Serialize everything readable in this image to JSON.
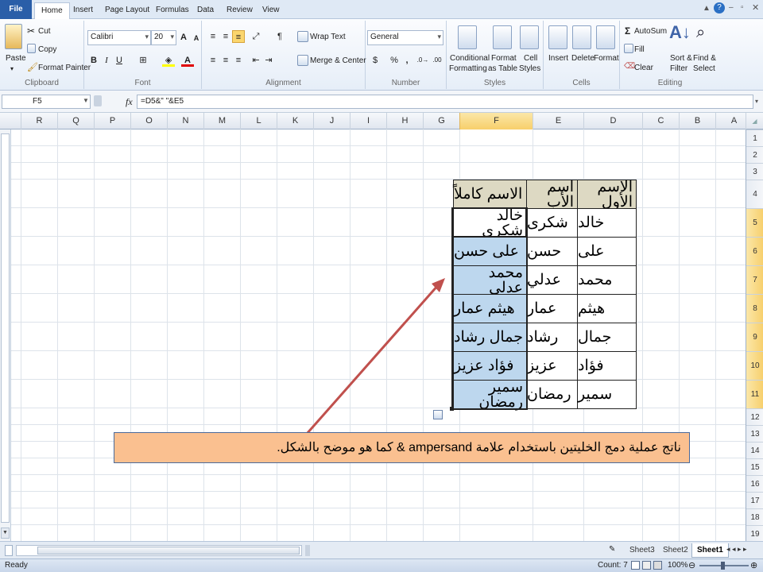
{
  "ribbon_tabs": [
    "File",
    "Home",
    "Insert",
    "Page Layout",
    "Formulas",
    "Data",
    "Review",
    "View"
  ],
  "clipboard": {
    "paste": "Paste",
    "cut": "Cut",
    "copy": "Copy",
    "format_painter": "Format Painter",
    "label": "Clipboard"
  },
  "font": {
    "name": "Calibri",
    "size": "20",
    "bold": "B",
    "italic": "I",
    "underline": "U",
    "label": "Font"
  },
  "alignment": {
    "wrap": "Wrap Text",
    "merge": "Merge & Center",
    "label": "Alignment"
  },
  "number": {
    "format": "General",
    "currency": "$",
    "percent": "%",
    "comma": ",",
    "label": "Number"
  },
  "styles": {
    "cond1": "Conditional",
    "cond2": "Formatting",
    "fmt1": "Format",
    "fmt2": "as Table",
    "cell1": "Cell",
    "cell2": "Styles",
    "label": "Styles"
  },
  "cells": {
    "insert": "Insert",
    "delete": "Delete",
    "format": "Format",
    "label": "Cells"
  },
  "editing": {
    "autosum": "AutoSum",
    "fill": "Fill",
    "clear": "Clear",
    "sort1": "Sort &",
    "sort2": "Filter",
    "find1": "Find &",
    "find2": "Select",
    "label": "Editing"
  },
  "formula_bar": {
    "name_box": "F5",
    "fx": "fx",
    "formula": "=D5&\" \"&E5"
  },
  "columns": [
    "R",
    "Q",
    "P",
    "O",
    "N",
    "M",
    "L",
    "K",
    "J",
    "I",
    "H",
    "G",
    "F",
    "E",
    "D",
    "C",
    "B",
    "A"
  ],
  "rows": [
    "1",
    "2",
    "3",
    "4",
    "5",
    "6",
    "7",
    "8",
    "9",
    "10",
    "11",
    "12",
    "13",
    "14",
    "15",
    "16",
    "17",
    "18",
    "19"
  ],
  "table": {
    "headers": [
      "الاسم كاملاً",
      "اسم الأب",
      "الاسم الأول"
    ],
    "rows": [
      [
        "خالد شكرى",
        "شكرى",
        "خالد"
      ],
      [
        "على حسن",
        "حسن",
        "على"
      ],
      [
        "محمد عدلي",
        "عدلي",
        "محمد"
      ],
      [
        "هيثم عمار",
        "عمار",
        "هيثم"
      ],
      [
        "جمال رشاد",
        "رشاد",
        "جمال"
      ],
      [
        "فؤاد عزيز",
        "عزيز",
        "فؤاد"
      ],
      [
        "سمير رمضان",
        "رمضان",
        "سمير"
      ]
    ]
  },
  "callout": "ناتج عملية دمج الخليتين باستخدام علامة ampersand & كما هو موضح بالشكل.",
  "sheets": [
    "Sheet3",
    "Sheet2",
    "Sheet1"
  ],
  "status": {
    "ready": "Ready",
    "count": "Count: 7",
    "zoom": "100%"
  },
  "colors": {
    "header_fill": "#ddd9c3",
    "merged_fill": "#bdd7ee",
    "callout_fill": "#fac090",
    "arrow": "#c0504d",
    "selection": "#f7cf6b"
  }
}
